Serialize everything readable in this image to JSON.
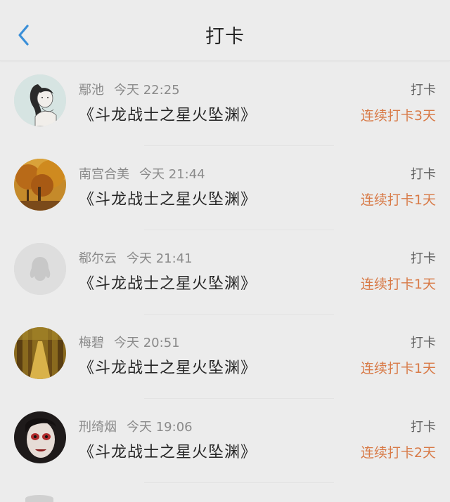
{
  "header": {
    "title": "打卡",
    "back_icon": "chevron-left-icon"
  },
  "colors": {
    "background": "#ececec",
    "back_icon": "#3a8fd8",
    "streak_text": "#d87a47",
    "name_text": "#8a8a8a",
    "book_text": "#262626"
  },
  "items": [
    {
      "name": "鄢池",
      "time": "今天 22:25",
      "book": "《斗龙战士之星火坠渊》",
      "action": "打卡",
      "streak": "连续打卡3天",
      "avatar": "sketch-girl-avatar"
    },
    {
      "name": "南宫合美",
      "time": "今天 21:44",
      "book": "《斗龙战士之星火坠渊》",
      "action": "打卡",
      "streak": "连续打卡1天",
      "avatar": "autumn-tree-avatar"
    },
    {
      "name": "郗尔云",
      "time": "今天 21:41",
      "book": "《斗龙战士之星火坠渊》",
      "action": "打卡",
      "streak": "连续打卡1天",
      "avatar": "default-penguin-avatar"
    },
    {
      "name": "梅碧",
      "time": "今天 20:51",
      "book": "《斗龙战士之星火坠渊》",
      "action": "打卡",
      "streak": "连续打卡1天",
      "avatar": "forest-path-avatar"
    },
    {
      "name": "刑绮烟",
      "time": "今天 19:06",
      "book": "《斗龙战士之星火坠渊》",
      "action": "打卡",
      "streak": "连续打卡2天",
      "avatar": "face-paint-avatar"
    }
  ]
}
